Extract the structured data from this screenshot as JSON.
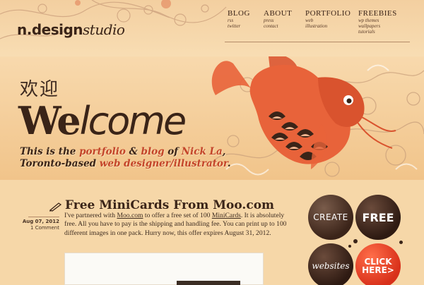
{
  "brand": {
    "logo_bold": "n.design",
    "logo_italic": "studio"
  },
  "nav": [
    {
      "label": "Blog",
      "subs": [
        "rss",
        "twitter"
      ]
    },
    {
      "label": "About",
      "subs": [
        "press",
        "contact"
      ]
    },
    {
      "label": "Portfolio",
      "subs": [
        "web",
        "illustration"
      ]
    },
    {
      "label": "Freebies",
      "subs": [
        "wp themes",
        "wallpapers",
        "tutorials"
      ]
    }
  ],
  "hero": {
    "chinese": "欢迎",
    "welcome_cap": "We",
    "welcome_rest": "lcome",
    "tagline": {
      "part1": "This is the ",
      "portfolio": "portfolio",
      "amp": " & ",
      "blog": "blog",
      "of": " of ",
      "name": "Nick La",
      "comma": ",",
      "line2": "Toronto-based ",
      "role": "web designer/illustrator",
      "end": "."
    }
  },
  "post": {
    "title": "Free MiniCards From Moo.com",
    "date": "Aug 07, 2012",
    "comments": "1 Comment",
    "body_before_link1": "I've partnered with ",
    "link1": "Moo.com",
    "body_mid1": " to offer a free set of 100 ",
    "link2": "MiniCards",
    "body_rest": ". It is absolutely free. All you have to pay is the shipping and handling fee. You can print up to 100 different images in one pack. Hurry now, this offer expires August 31, 2012."
  },
  "sidebar": {
    "create": "CREATE",
    "free": "FREE",
    "websites": "websites",
    "click_line1": "CLICK",
    "click_line2": "HERE>"
  },
  "colors": {
    "background": "#f6d7a8",
    "accent": "#c4452a",
    "text": "#3a2418",
    "koi": "#e8633a"
  },
  "icons": [
    "pencil-icon",
    "koi-fish-illustration",
    "swirl-ornament"
  ]
}
